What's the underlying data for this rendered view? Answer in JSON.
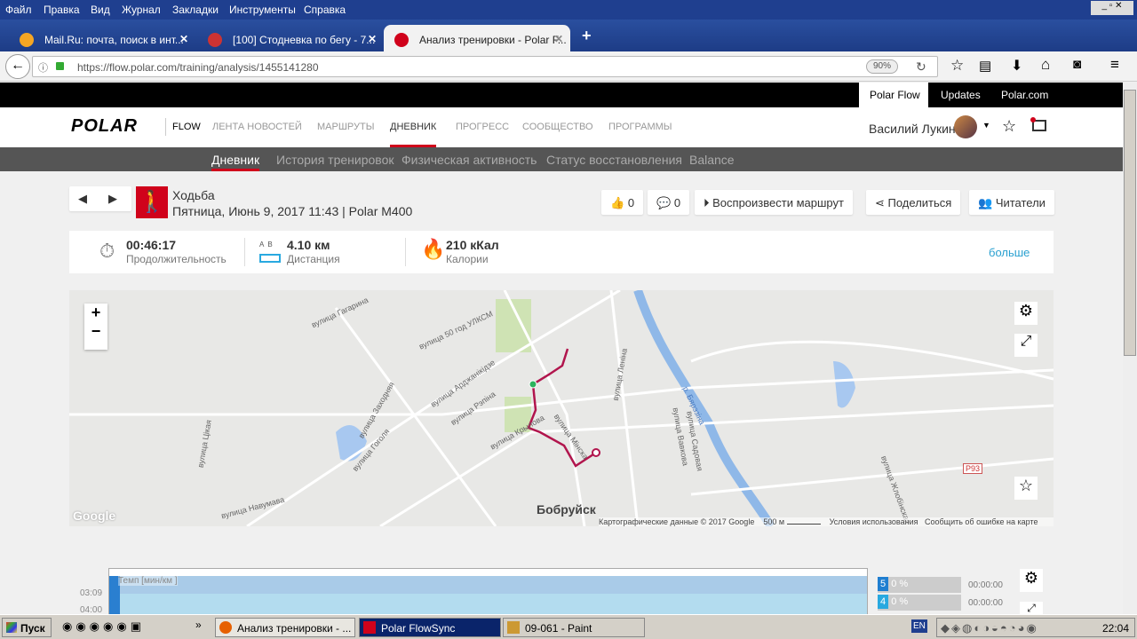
{
  "browser": {
    "menu": [
      "Файл",
      "Правка",
      "Вид",
      "Журнал",
      "Закладки",
      "Инструменты",
      "Справка"
    ],
    "tabs": [
      {
        "title": "Mail.Ru: почта, поиск в инт...",
        "active": false
      },
      {
        "title": "[100] Стодневка по бегу - 7...",
        "active": false
      },
      {
        "title": "Анализ тренировки - Polar F...",
        "active": true
      }
    ],
    "new_tab": "+",
    "url": "https://flow.polar.com/training/analysis/1455141280",
    "zoom": "90%"
  },
  "site": {
    "top_links": [
      "Polar Flow",
      "Updates",
      "Polar.com"
    ],
    "logo": "POLAR",
    "logo_sub": "FLOW",
    "nav": [
      "ЛЕНТА НОВОСТЕЙ",
      "МАРШРУТЫ",
      "ДНЕВНИК",
      "ПРОГРЕСС",
      "СООБЩЕСТВО",
      "ПРОГРАММЫ"
    ],
    "active_nav": "ДНЕВНИК",
    "user": "Василий Лукин",
    "subnav": [
      "Дневник",
      "История тренировок",
      "Физическая активность",
      "Статус восстановления",
      "Balance"
    ],
    "accent": "#d0021b"
  },
  "training": {
    "sport": "Ходьба",
    "details": "Пятница, Июнь 9, 2017 11:43 | Polar M400",
    "likes": "0",
    "comments": "0",
    "play_route": "Воспроизвести маршрут",
    "share": "Поделиться",
    "readers": "Читатели"
  },
  "stats": {
    "duration": {
      "value": "00:46:17",
      "label": "Продолжительность"
    },
    "distance": {
      "ab": "A  B",
      "value": "4.10 км",
      "label": "Дистанция"
    },
    "calories": {
      "value": "210 кКал",
      "label": "Калории"
    },
    "more": "больше"
  },
  "map": {
    "city": "Бобруйск",
    "labels": [
      "вулица Гагарина",
      "вулица 50 год УЛКСМ",
      "вулица Арджанікідзе",
      "вулица Рэпіна",
      "вулица Заходняя",
      "вулица Гоголя",
      "вулица Цікая",
      "вулица Крылова",
      "вулица Мінска",
      "вулица Леніна",
      "р. Бярэзіна",
      "вулица Вавкова",
      "вулица Садовая",
      "вулица Навумава",
      "вулица Жлобінская",
      "Р93"
    ],
    "google": "Google",
    "copyright": "Картографические данные © 2017 Google",
    "scale": "500 м",
    "terms": "Условия использования",
    "report": "Сообщить об ошибке на карте",
    "zoom_in": "+",
    "zoom_out": "−"
  },
  "chart": {
    "title": "Темп [мин/км ]",
    "y_ticks": [
      "03:09",
      "04:00"
    ],
    "zones": [
      {
        "zone": "5",
        "pct": "0 %",
        "time": "00:00:00"
      },
      {
        "zone": "4",
        "pct": "0 %",
        "time": "00:00:00"
      }
    ]
  },
  "taskbar": {
    "start": "Пуск",
    "more": "»",
    "windows": [
      "Анализ тренировки - ...",
      "Polar FlowSync",
      "09-061 - Paint"
    ],
    "lang": "EN",
    "clock": "22:04"
  }
}
